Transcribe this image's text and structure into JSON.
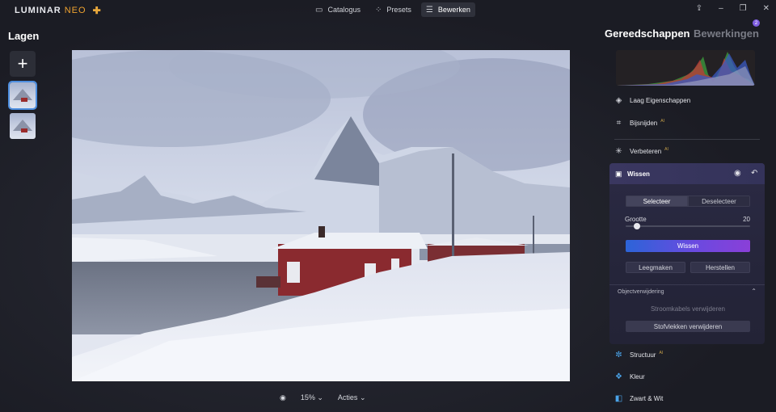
{
  "app": {
    "logo_main": "LUMINAR",
    "logo_sub": "NEO"
  },
  "nav": {
    "tabs": [
      {
        "label": "Catalogus",
        "icon": "folder-icon"
      },
      {
        "label": "Presets",
        "icon": "wand-icon"
      },
      {
        "label": "Bewerken",
        "icon": "sliders-icon",
        "active": true
      }
    ]
  },
  "layers": {
    "title": "Lagen"
  },
  "panel": {
    "tools_title": "Gereedschappen",
    "edits_title": "Bewerkingen",
    "edits_badge": "2"
  },
  "tools": [
    {
      "label": "Laag Eigenschappen",
      "icon": "layers-icon",
      "ai": ""
    },
    {
      "label": "Bijsnijden",
      "icon": "crop-icon",
      "ai": "AI"
    },
    {
      "label": "Verbeteren",
      "icon": "sparkle-icon",
      "ai": "AI"
    }
  ],
  "erase": {
    "title": "Wissen",
    "select_label": "Selecteer",
    "deselect_label": "Deselecteer",
    "size_label": "Grootte",
    "size_value": "20",
    "size_fraction": 0.07,
    "erase_button": "Wissen",
    "clear_button": "Leegmaken",
    "reset_button": "Herstellen",
    "object_removal_label": "Objectverwijdering",
    "power_lines_label": "Stroomkabels verwijderen",
    "dust_label": "Stofvlekken verwijderen"
  },
  "more_tools": [
    {
      "label": "Structuur",
      "icon": "structure-icon",
      "ai": "AI"
    },
    {
      "label": "Kleur",
      "icon": "color-icon",
      "ai": ""
    },
    {
      "label": "Zwart & Wit",
      "icon": "bw-icon",
      "ai": ""
    }
  ],
  "bottom": {
    "zoom": "15%",
    "actions": "Acties"
  },
  "colors": {
    "accent_start": "#2c64d8",
    "accent_end": "#8a3fd8",
    "panel_bg": "#2b2a44"
  }
}
